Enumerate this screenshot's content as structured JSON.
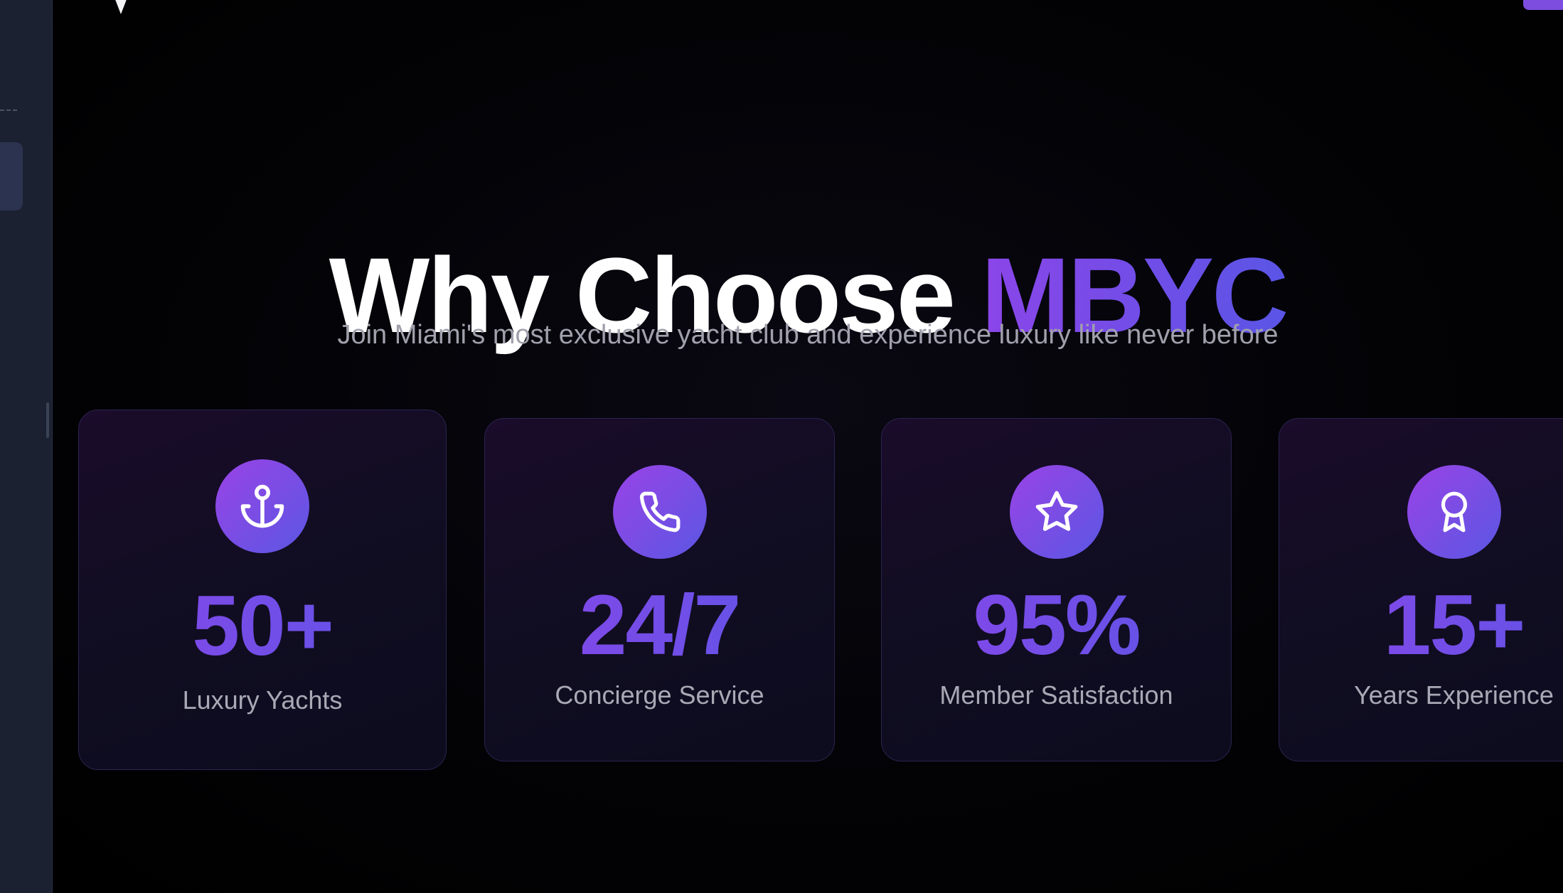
{
  "heading": {
    "prefix": "Why Choose",
    "accent": "MBYC"
  },
  "subtitle": "Join Miami's most exclusive yacht club and experience luxury like never before",
  "stats": [
    {
      "icon": "anchor-icon",
      "value": "50+",
      "label": "Luxury Yachts"
    },
    {
      "icon": "phone-icon",
      "value": "24/7",
      "label": "Concierge Service"
    },
    {
      "icon": "star-icon",
      "value": "95%",
      "label": "Member Satisfaction"
    },
    {
      "icon": "award-icon",
      "value": "15+",
      "label": "Years Experience"
    }
  ],
  "colors": {
    "accent_start": "#8b45e8",
    "accent_end": "#5a55e6",
    "background": "#000000",
    "muted_text": "#a1a1ad"
  }
}
